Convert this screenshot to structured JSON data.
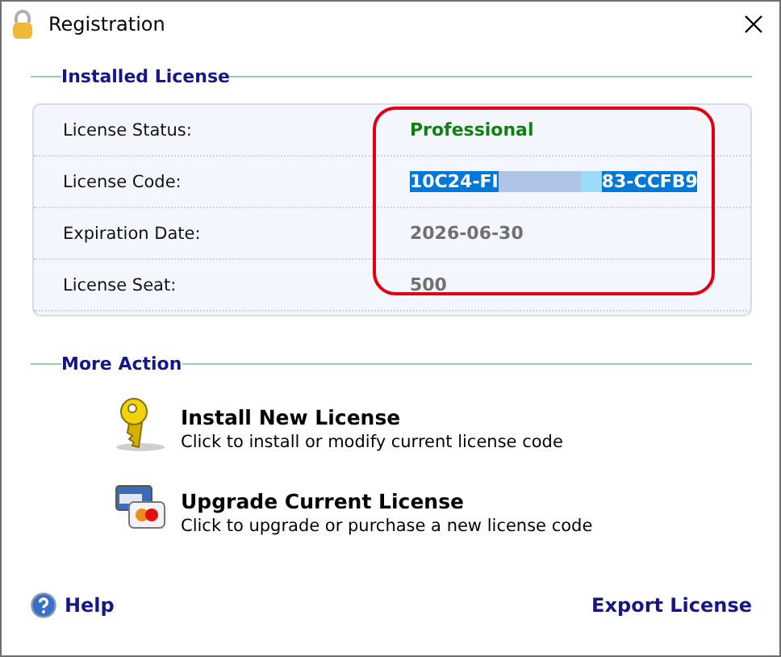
{
  "window": {
    "title": "Registration"
  },
  "installed_license": {
    "heading": "Installed License",
    "highlighted": true,
    "rows": [
      {
        "label": "License Status:",
        "kind": "status",
        "value": "Professional"
      },
      {
        "label": "License Code:",
        "kind": "code",
        "value_start": "10C24-FI",
        "value_end": "83-CCFB9",
        "selected": true
      },
      {
        "label": "Expiration Date:",
        "kind": "text",
        "value": "2026-06-30"
      },
      {
        "label": "License Seat:",
        "kind": "text",
        "value": "500"
      }
    ]
  },
  "more_action": {
    "heading": "More Action",
    "actions": [
      {
        "kind": "key",
        "title": "Install New License",
        "description": "Click to install or modify current license code"
      },
      {
        "kind": "card",
        "title": "Upgrade Current License",
        "description": "Click to upgrade or purchase a new license code"
      }
    ]
  },
  "footer": {
    "help": "Help",
    "export": "Export License"
  }
}
